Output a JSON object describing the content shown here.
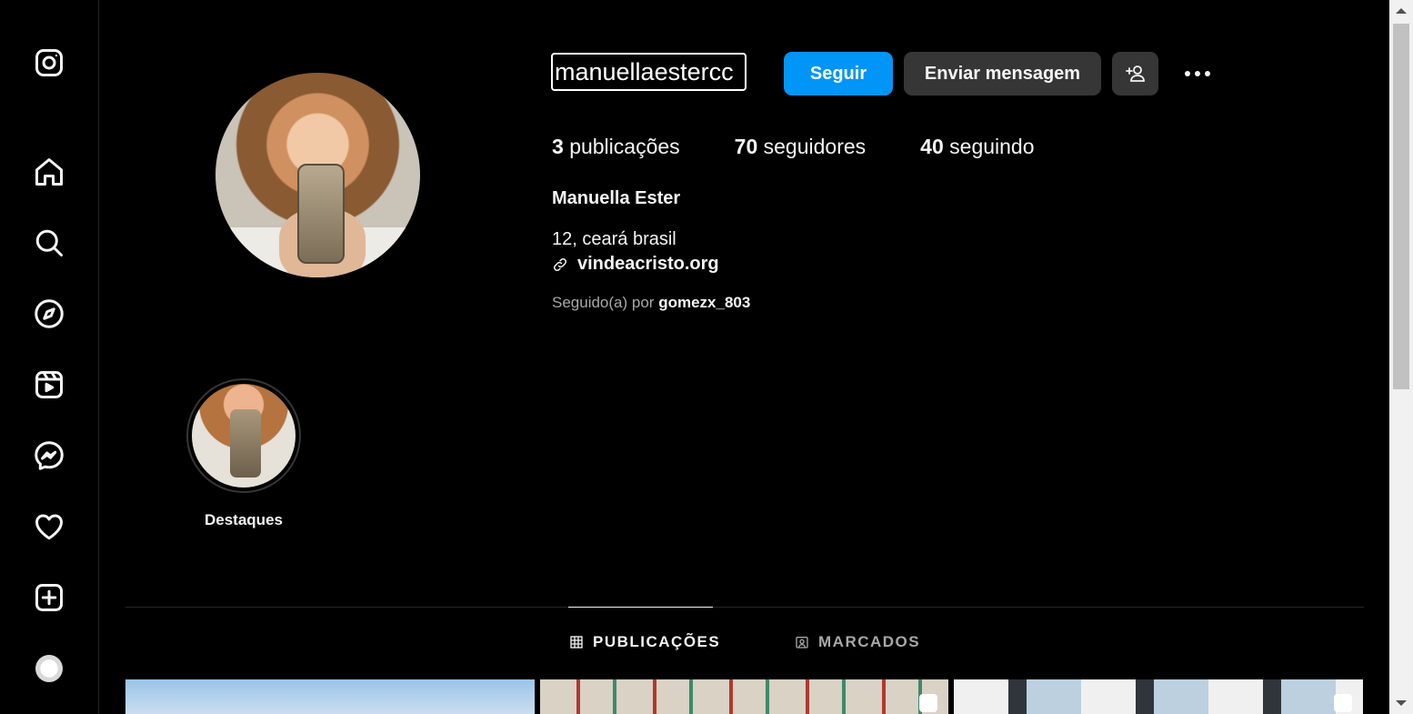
{
  "sidebar": {
    "items": [
      {
        "icon": "instagram-logo-icon"
      },
      {
        "icon": "home-icon"
      },
      {
        "icon": "search-icon"
      },
      {
        "icon": "explore-compass-icon"
      },
      {
        "icon": "reels-icon"
      },
      {
        "icon": "messenger-icon"
      },
      {
        "icon": "heart-icon"
      },
      {
        "icon": "create-plus-icon"
      },
      {
        "icon": "profile-avatar-icon"
      }
    ]
  },
  "profile": {
    "username": "manuellaestercc",
    "follow_label": "Seguir",
    "message_label": "Enviar mensagem",
    "stats": {
      "posts_count": "3",
      "posts_label": "publicações",
      "followers_count": "70",
      "followers_label": "seguidores",
      "following_count": "40",
      "following_label": "seguindo"
    },
    "full_name": "Manuella Ester",
    "bio": "12, ceará brasil",
    "link": "vindeacristo.org",
    "followed_by_prefix": "Seguido(a) por",
    "followed_by_user": "gomezx_803"
  },
  "highlights": [
    {
      "label": "Destaques"
    }
  ],
  "tabs": [
    {
      "label": "PUBLICAÇÕES",
      "active": true
    },
    {
      "label": "MARCADOS",
      "active": false
    }
  ],
  "colors": {
    "background": "#000000",
    "accent": "#0095f6",
    "button_secondary": "#363636",
    "text_primary": "#f5f5f5",
    "text_secondary": "#a8a8a8"
  }
}
